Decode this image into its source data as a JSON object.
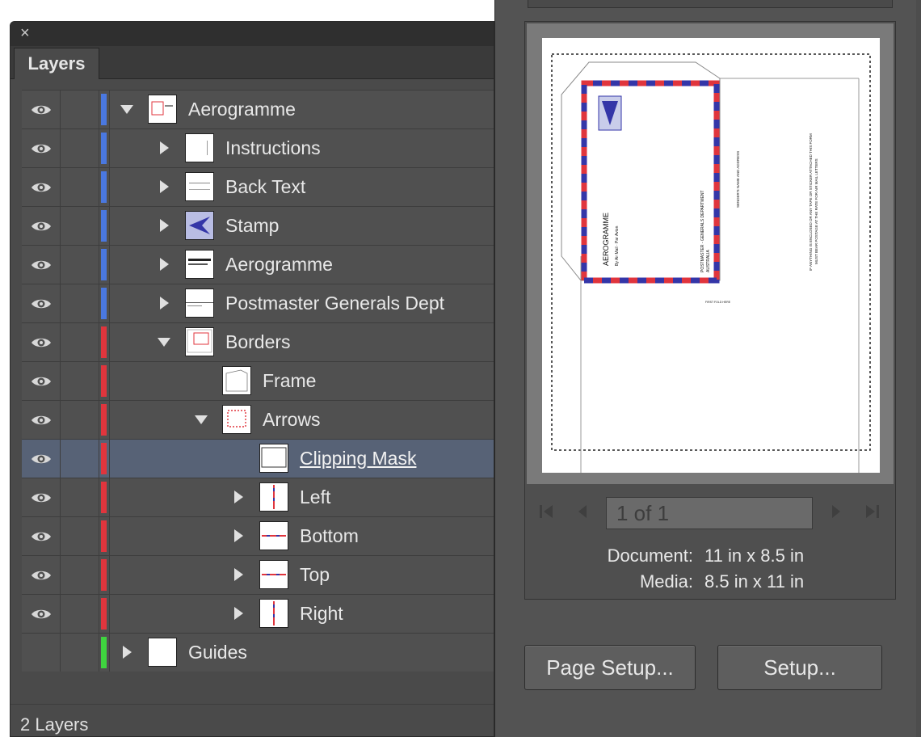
{
  "layers_panel": {
    "tab_label": "Layers",
    "close_icon": "×",
    "footer_count": "2 Layers",
    "colors": {
      "blue": "#4a78e0",
      "red": "#e0353d",
      "green": "#3fd43f"
    },
    "rows": [
      {
        "name": "Aerogramme",
        "level": 0,
        "expanded": true,
        "eye": true,
        "color": "blue",
        "thumb": "aerogramme-thumb"
      },
      {
        "name": "Instructions",
        "level": 1,
        "expanded": false,
        "eye": true,
        "color": "blue",
        "thumb": "instructions-thumb"
      },
      {
        "name": "Back Text",
        "level": 1,
        "expanded": false,
        "eye": true,
        "color": "blue",
        "thumb": "back-text-thumb"
      },
      {
        "name": "Stamp",
        "level": 1,
        "expanded": false,
        "eye": true,
        "color": "blue",
        "thumb": "stamp-thumb"
      },
      {
        "name": "Aerogramme",
        "level": 1,
        "expanded": false,
        "eye": true,
        "color": "blue",
        "thumb": "aerogramme-text-thumb"
      },
      {
        "name": "Postmaster Generals Dept",
        "level": 1,
        "expanded": false,
        "eye": true,
        "color": "blue",
        "thumb": "postmaster-thumb"
      },
      {
        "name": "Borders",
        "level": 1,
        "expanded": true,
        "eye": true,
        "color": "red",
        "thumb": "borders-thumb"
      },
      {
        "name": "Frame",
        "level": 2,
        "expanded": null,
        "eye": true,
        "color": "red",
        "thumb": "frame-thumb"
      },
      {
        "name": "Arrows",
        "level": 2,
        "expanded": true,
        "eye": true,
        "color": "red",
        "thumb": "arrows-thumb"
      },
      {
        "name": "Clipping Mask",
        "level": 3,
        "expanded": null,
        "eye": true,
        "color": "red",
        "thumb": "clipping-thumb",
        "selected": true
      },
      {
        "name": "Left",
        "level": 3,
        "expanded": false,
        "eye": true,
        "color": "red",
        "thumb": "left-thumb"
      },
      {
        "name": "Bottom",
        "level": 3,
        "expanded": false,
        "eye": true,
        "color": "red",
        "thumb": "bottom-thumb"
      },
      {
        "name": "Top",
        "level": 3,
        "expanded": false,
        "eye": true,
        "color": "red",
        "thumb": "top-thumb"
      },
      {
        "name": "Right",
        "level": 3,
        "expanded": false,
        "eye": true,
        "color": "red",
        "thumb": "right-thumb"
      },
      {
        "name": "Guides",
        "level": 0,
        "expanded": false,
        "eye": false,
        "color": "green",
        "thumb": "blank-thumb"
      }
    ]
  },
  "print_dialog": {
    "page_indicator": "1 of 1",
    "document_label": "Document:",
    "document_value": "11 in x 8.5 in",
    "media_label": "Media:",
    "media_value": "8.5 in x 11 in",
    "page_setup_button": "Page Setup...",
    "setup_button": "Setup...",
    "preview_text": {
      "title": "AEROGRAMME",
      "subtitle": "By Air Mail · Par Avion",
      "postmaster": "POSTMASTER - GENERALS DEPARTMENT",
      "country": "AUSTRALIA",
      "sender": "SENDER'S NAME AND ADDRESS",
      "warning_line1": "IF ANYTHING IS ENCLOSED OR ANY TAPE OR STICKER ATTACHED THIS FORM",
      "warning_line2": "MUST BEAR POSTAGE AT THE RATE FOR AIR MAIL LETTERS",
      "first_fold": "FIRST FOLD HERE"
    },
    "colors": {
      "airmail_red": "#e0353d",
      "airmail_blue": "#3436a8"
    }
  }
}
